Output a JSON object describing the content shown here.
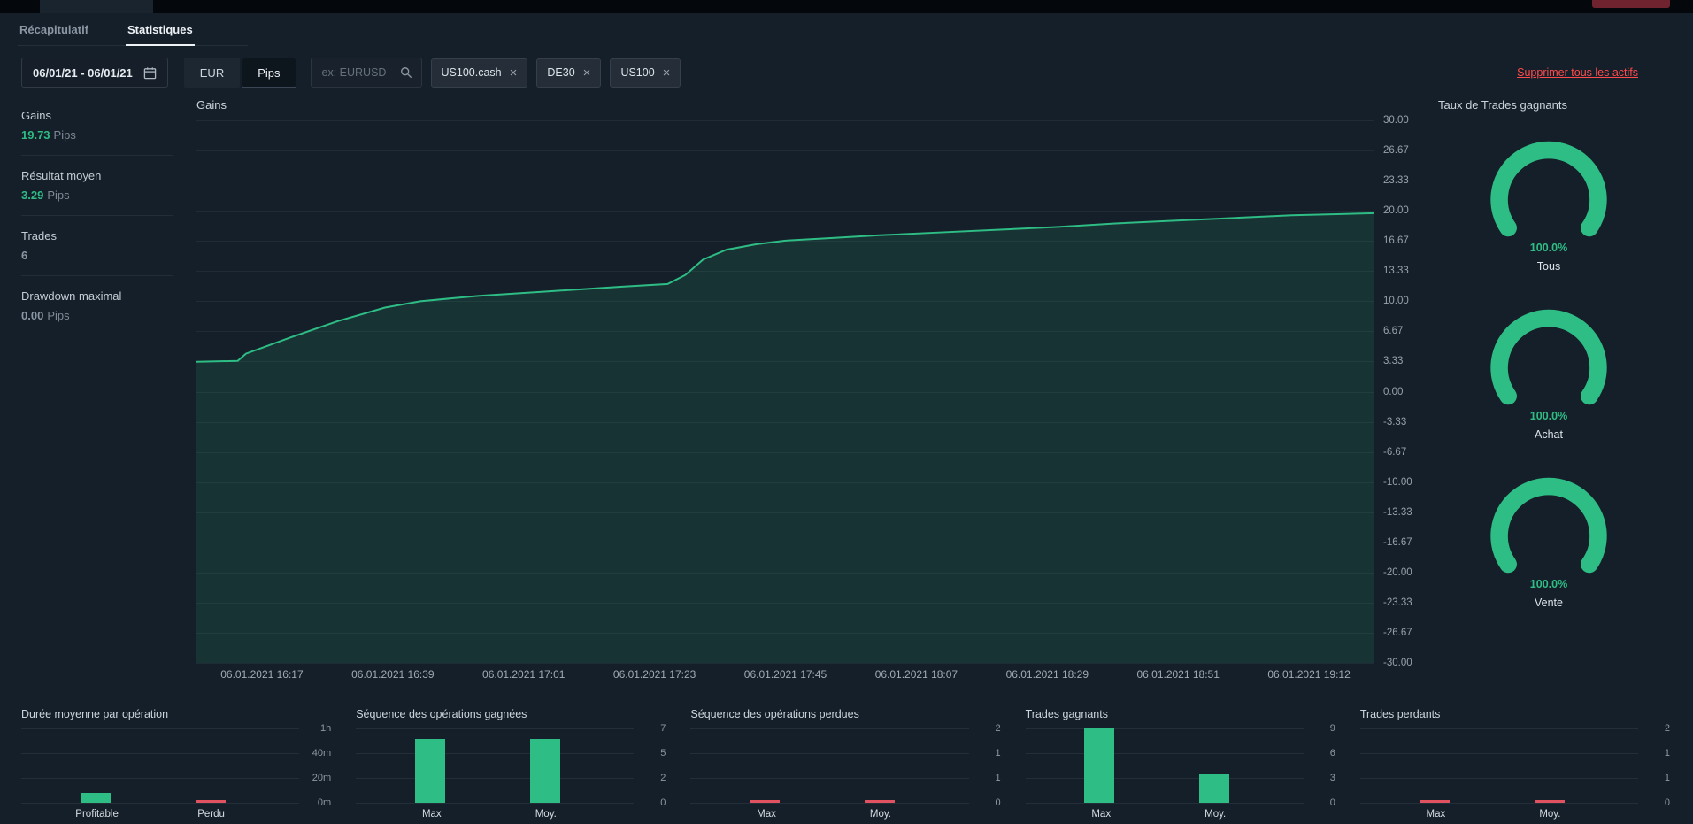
{
  "header": {
    "tabs": [
      {
        "label": "Récapitulatif",
        "active": false
      },
      {
        "label": "Statistiques",
        "active": true
      }
    ]
  },
  "filters": {
    "date_range": "06/01/21 - 06/01/21",
    "currency_button": "EUR",
    "unit_button": "Pips",
    "search_placeholder": "ex: EURUSD",
    "asset_chips": [
      "US100.cash",
      "DE30",
      "US100"
    ],
    "remove_all_link": "Supprimer tous les actifs"
  },
  "icons": {
    "close": "×"
  },
  "stats": [
    {
      "label": "Gains",
      "value": "19.73",
      "unit": "Pips"
    },
    {
      "label": "Résultat moyen",
      "value": "3.29",
      "unit": "Pips"
    },
    {
      "label": "Trades",
      "value": "6",
      "unit": ""
    },
    {
      "label": "Drawdown maximal",
      "value": "0.00",
      "unit": "Pips"
    }
  ],
  "gauges": {
    "title": "Taux de Trades gagnants",
    "items": [
      {
        "value": "100.0%",
        "label": "Tous"
      },
      {
        "value": "100.0%",
        "label": "Achat"
      },
      {
        "value": "100.0%",
        "label": "Vente"
      }
    ]
  },
  "theme": {
    "green": "#2ebd85",
    "red": "#e05260",
    "link_red": "#ff4b4b",
    "line": "#2ebd85",
    "fill": "rgba(46,189,133,0.13)"
  },
  "chart_data": [
    {
      "id": "gains",
      "type": "area",
      "title": "Gains",
      "ylabel": "Pips",
      "ylim": [
        -30,
        30
      ],
      "ytick_labels": [
        "30.00",
        "26.67",
        "23.33",
        "20.00",
        "16.67",
        "13.33",
        "10.00",
        "6.67",
        "3.33",
        "0.00",
        "-3.33",
        "-6.67",
        "-10.00",
        "-13.33",
        "-16.67",
        "-20.00",
        "-23.33",
        "-26.67",
        "-30.00"
      ],
      "x_labels": [
        "06.01.2021 16:17",
        "06.01.2021 16:39",
        "06.01.2021 17:01",
        "06.01.2021 17:23",
        "06.01.2021 17:45",
        "06.01.2021 18:07",
        "06.01.2021 18:29",
        "06.01.2021 18:51",
        "06.01.2021 19:12"
      ],
      "points": [
        [
          0,
          3.3
        ],
        [
          3.5,
          3.4
        ],
        [
          4.2,
          4.2
        ],
        [
          8,
          6.0
        ],
        [
          12,
          7.8
        ],
        [
          16,
          9.3
        ],
        [
          19,
          10.0
        ],
        [
          24,
          10.6
        ],
        [
          30,
          11.1
        ],
        [
          36,
          11.6
        ],
        [
          40,
          11.9
        ],
        [
          41.5,
          12.9
        ],
        [
          43,
          14.6
        ],
        [
          45,
          15.7
        ],
        [
          47.5,
          16.3
        ],
        [
          50,
          16.7
        ],
        [
          54,
          17.0
        ],
        [
          58,
          17.3
        ],
        [
          63,
          17.6
        ],
        [
          68,
          17.9
        ],
        [
          73,
          18.2
        ],
        [
          78,
          18.6
        ],
        [
          83,
          18.9
        ],
        [
          88,
          19.2
        ],
        [
          93,
          19.5
        ],
        [
          100,
          19.73
        ]
      ],
      "final_value": 19.73,
      "grid": true,
      "legend": false
    },
    {
      "id": "duration",
      "type": "bar",
      "title": "Durée moyenne par opération",
      "categories": [
        "Profitable",
        "Perdu"
      ],
      "values": [
        8,
        0
      ],
      "ymax": 60,
      "unit": "minutes",
      "yticks": [
        "1h",
        "40m",
        "20m",
        "0m"
      ],
      "colors": [
        "#2ebd85",
        "#e05260"
      ]
    },
    {
      "id": "win-streak",
      "type": "bar",
      "title": "Séquence des opérations gagnées",
      "categories": [
        "Max",
        "Moy."
      ],
      "values": [
        6,
        6
      ],
      "ymax": 7,
      "yticks": [
        "7",
        "5",
        "2",
        "0"
      ],
      "colors": [
        "#2ebd85",
        "#2ebd85"
      ]
    },
    {
      "id": "loss-streak",
      "type": "bar",
      "title": "Séquence des opérations perdues",
      "categories": [
        "Max",
        "Moy."
      ],
      "values": [
        0,
        0
      ],
      "ymax": 2,
      "yticks": [
        "2",
        "1",
        "1",
        "0"
      ],
      "colors": [
        "#e05260",
        "#e05260"
      ]
    },
    {
      "id": "winning-trades",
      "type": "bar",
      "title": "Trades gagnants",
      "categories": [
        "Max",
        "Moy."
      ],
      "values": [
        9,
        3.5
      ],
      "ymax": 9,
      "yticks": [
        "9",
        "6",
        "3",
        "0"
      ],
      "colors": [
        "#2ebd85",
        "#2ebd85"
      ]
    },
    {
      "id": "losing-trades",
      "type": "bar",
      "title": "Trades perdants",
      "categories": [
        "Max",
        "Moy."
      ],
      "values": [
        0,
        0
      ],
      "ymax": 2,
      "yticks": [
        "2",
        "1",
        "1",
        "0"
      ],
      "colors": [
        "#e05260",
        "#e05260"
      ]
    }
  ]
}
